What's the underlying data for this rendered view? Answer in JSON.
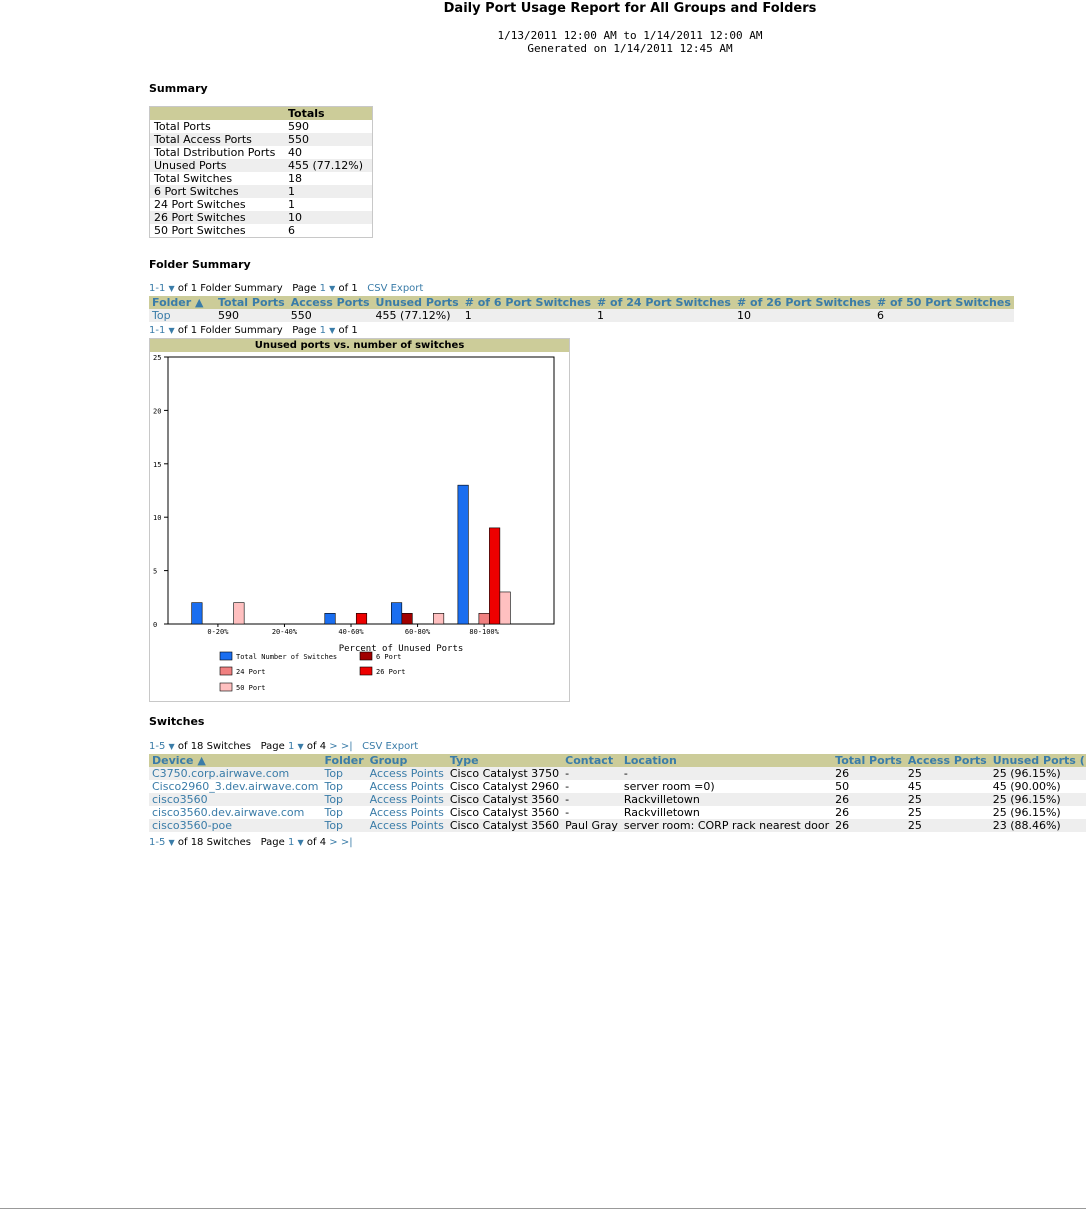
{
  "report": {
    "title": "Daily Port Usage Report for All Groups and Folders",
    "date_range": "1/13/2011 12:00 AM to 1/14/2011 12:00 AM",
    "generated": "Generated on 1/14/2011 12:45 AM"
  },
  "summary": {
    "heading": "Summary",
    "col_header": "Totals",
    "rows": [
      {
        "label": "Total Ports",
        "value": "590"
      },
      {
        "label": "Total Access Ports",
        "value": "550"
      },
      {
        "label": "Total Dstribution Ports",
        "value": "40"
      },
      {
        "label": "Unused Ports",
        "value": "455 (77.12%)"
      },
      {
        "label": "Total Switches",
        "value": "18"
      },
      {
        "label": "6 Port Switches",
        "value": "1"
      },
      {
        "label": "24 Port Switches",
        "value": "1"
      },
      {
        "label": "26 Port Switches",
        "value": "10"
      },
      {
        "label": "50 Port Switches",
        "value": "6"
      }
    ]
  },
  "folder_summary": {
    "heading": "Folder Summary",
    "pager_top": {
      "range": "1-1",
      "of_text": "of 1 Folder Summary",
      "page_label": "Page",
      "page": "1",
      "page_of": "of 1",
      "export": "CSV Export"
    },
    "pager_bottom": {
      "range": "1-1",
      "of_text": "of 1 Folder Summary",
      "page_label": "Page",
      "page": "1",
      "page_of": "of 1"
    },
    "columns": [
      "Folder ▲",
      "Total Ports",
      "Access Ports",
      "Unused Ports",
      "# of 6 Port Switches",
      "# of 24 Port Switches",
      "# of 26 Port Switches",
      "# of 50 Port Switches"
    ],
    "rows": [
      [
        "Top",
        "590",
        "550",
        "455 (77.12%)",
        "1",
        "1",
        "10",
        "6"
      ]
    ]
  },
  "chart_data": {
    "type": "bar",
    "title": "Unused ports vs. number of switches",
    "xlabel": "Percent of Unused Ports",
    "ylabel": "",
    "ylim": [
      0,
      25
    ],
    "yticks": [
      0,
      5,
      10,
      15,
      20,
      25
    ],
    "categories": [
      "0-20%",
      "20-40%",
      "40-60%",
      "60-80%",
      "80-100%"
    ],
    "series": [
      {
        "name": "Total Number of Switches",
        "color": "#1a6ef0",
        "values": [
          2,
          0,
          1,
          2,
          13
        ]
      },
      {
        "name": "6 Port",
        "color": "#a00000",
        "values": [
          0,
          0,
          0,
          1,
          0
        ]
      },
      {
        "name": "24 Port",
        "color": "#f08080",
        "values": [
          0,
          0,
          0,
          0,
          1
        ]
      },
      {
        "name": "26 Port",
        "color": "#ee0000",
        "values": [
          0,
          0,
          1,
          0,
          9
        ]
      },
      {
        "name": "50 Port",
        "color": "#ffc0c0",
        "values": [
          2,
          0,
          0,
          1,
          3
        ]
      }
    ],
    "legend_position": "bottom"
  },
  "switches": {
    "heading": "Switches",
    "pager_top": {
      "range": "1-5",
      "of_text": "of 18 Switches",
      "page_label": "Page",
      "page": "1",
      "page_of": "of 4",
      "next": ">",
      "last": ">|",
      "export": "CSV Export"
    },
    "pager_bottom": {
      "range": "1-5",
      "of_text": "of 18 Switches",
      "page_label": "Page",
      "page": "1",
      "page_of": "of 4",
      "next": ">",
      "last": ">|"
    },
    "columns": [
      "Device ▲",
      "Folder",
      "Group",
      "Type",
      "Contact",
      "Location",
      "Total Ports",
      "Access Ports",
      "Unused Ports ("
    ],
    "rows": [
      [
        "C3750.corp.airwave.com",
        "Top",
        "Access Points",
        "Cisco Catalyst 3750",
        "-",
        "-",
        "26",
        "25",
        "25 (96.15%)"
      ],
      [
        "Cisco2960_3.dev.airwave.com",
        "Top",
        "Access Points",
        "Cisco Catalyst 2960",
        "-",
        "server room =0)",
        "50",
        "45",
        "45 (90.00%)"
      ],
      [
        "cisco3560",
        "Top",
        "Access Points",
        "Cisco Catalyst 3560",
        "-",
        "Rackvilletown",
        "26",
        "25",
        "25 (96.15%)"
      ],
      [
        "cisco3560.dev.airwave.com",
        "Top",
        "Access Points",
        "Cisco Catalyst 3560",
        "-",
        "Rackvilletown",
        "26",
        "25",
        "25 (96.15%)"
      ],
      [
        "cisco3560-poe",
        "Top",
        "Access Points",
        "Cisco Catalyst 3560",
        "Paul Gray",
        "server room: CORP rack nearest door",
        "26",
        "25",
        "23 (88.46%)"
      ]
    ]
  },
  "icons": {
    "dropdown": "triangle-down-icon",
    "sort": "sort-ascending-icon"
  }
}
